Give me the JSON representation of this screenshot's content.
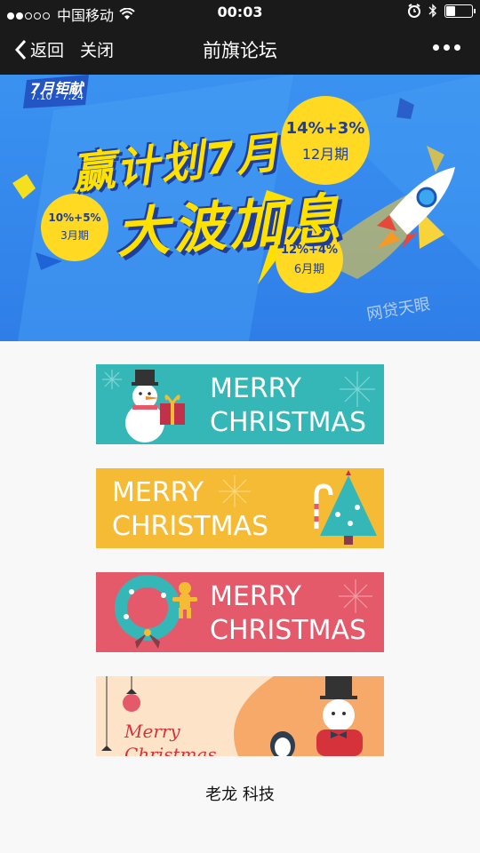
{
  "status_bar": {
    "carrier": "中国移动",
    "time": "00:03"
  },
  "nav": {
    "back_label": "返回",
    "close_label": "关闭",
    "title": "前旗论坛"
  },
  "banner": {
    "badge_title": "7月钜献",
    "badge_dates": "7.10 - 7.24",
    "headline_1": "赢计划7月",
    "headline_2": "大波加息",
    "offers": [
      {
        "rate": "14%+3%",
        "term": "12月期"
      },
      {
        "rate": "10%+5%",
        "term": "3月期"
      },
      {
        "rate": "12%+4%",
        "term": "6月期"
      }
    ],
    "watermark": "网贷天眼"
  },
  "cards": [
    {
      "line1": "MERRY",
      "line2": "CHRISTMAS",
      "bg": "#35b7b8"
    },
    {
      "line1": "MERRY",
      "line2": "CHRISTMAS",
      "bg": "#f5bb35"
    },
    {
      "line1": "MERRY",
      "line2": "CHRISTMAS",
      "bg": "#e55a6a"
    },
    {
      "line1": "Merry",
      "line2": "Christmas",
      "bg": "#f7a96a"
    }
  ],
  "footer": {
    "text": "老龙 科技"
  }
}
